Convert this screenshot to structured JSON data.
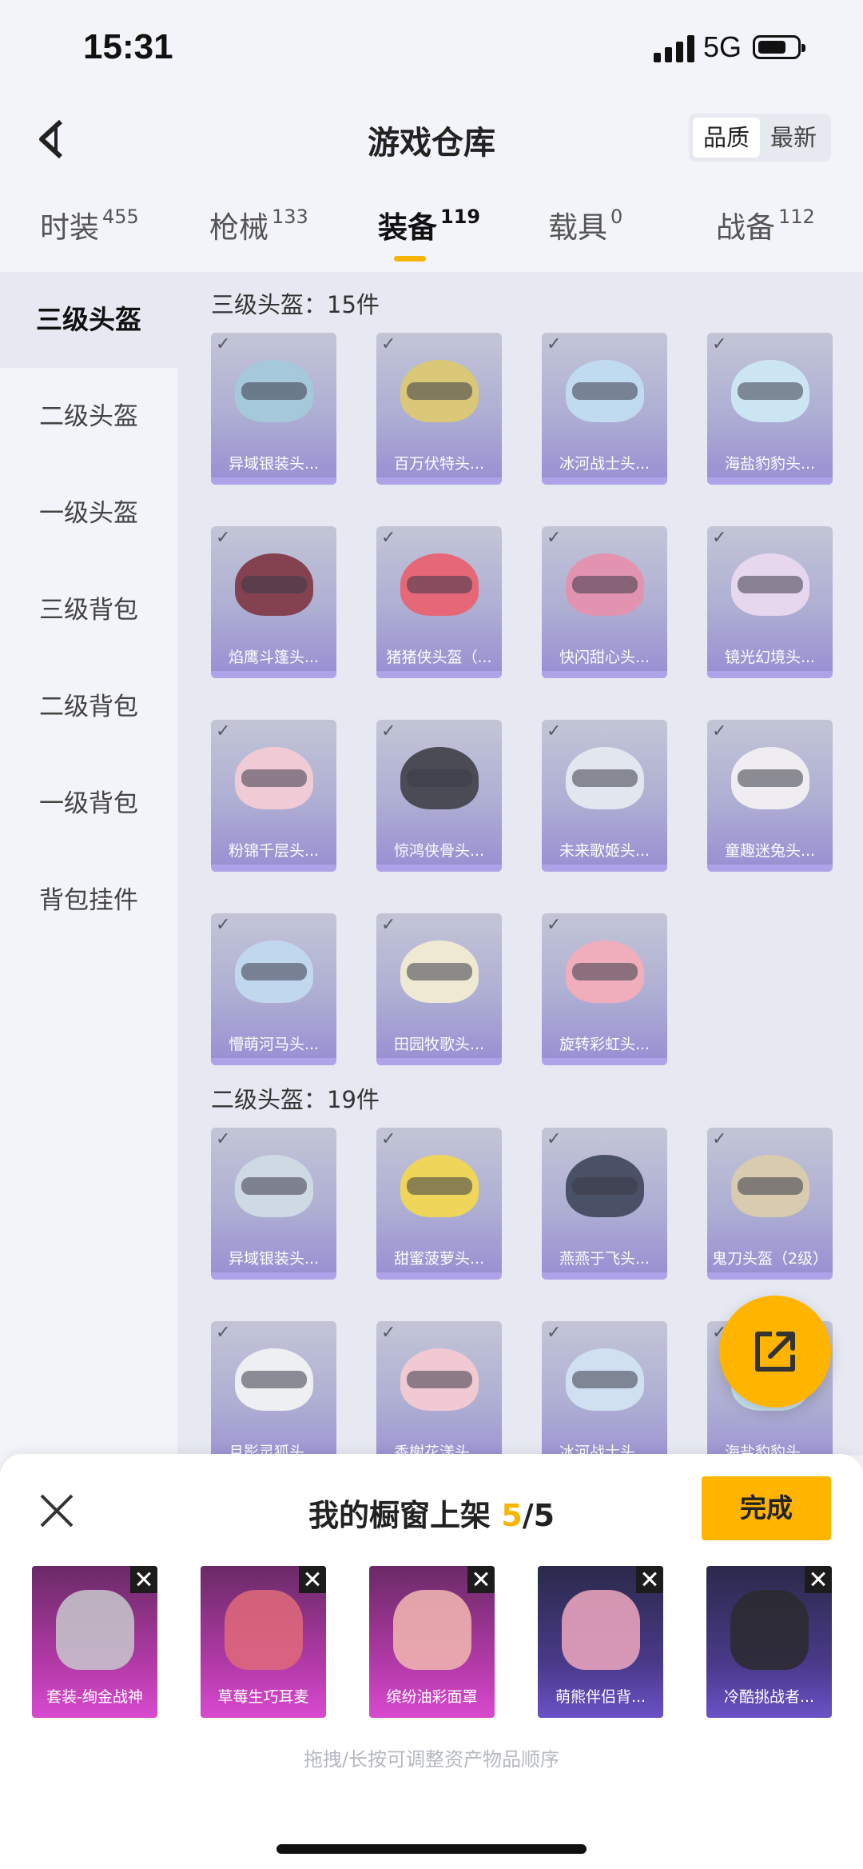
{
  "status_bar": {
    "time": "15:31",
    "network": "5G"
  },
  "header": {
    "title": "游戏仓库",
    "sort_options": [
      "品质",
      "最新"
    ],
    "sort_selected": "品质"
  },
  "tabs": [
    {
      "label": "时装",
      "count": "455"
    },
    {
      "label": "枪械",
      "count": "133"
    },
    {
      "label": "装备",
      "count": "119",
      "active": true
    },
    {
      "label": "载具",
      "count": "0"
    },
    {
      "label": "战备",
      "count": "112"
    }
  ],
  "sidebar": {
    "items": [
      "三级头盔",
      "二级头盔",
      "一级头盔",
      "三级背包",
      "二级背包",
      "一级背包",
      "背包挂件"
    ],
    "active_index": 0
  },
  "sections": [
    {
      "title": "三级头盔：15件",
      "items": [
        {
          "name": "异域银装头...",
          "color": "#9ec6d8"
        },
        {
          "name": "百万伏特头...",
          "color": "#d9c46a"
        },
        {
          "name": "冰河战士头...",
          "color": "#bcd9f0"
        },
        {
          "name": "海盐豹豹头...",
          "color": "#c9e6f3"
        },
        {
          "name": "焰鹰斗篷头...",
          "color": "#7a3040"
        },
        {
          "name": "猪猪侠头盔（...",
          "color": "#e65a6a"
        },
        {
          "name": "快闪甜心头...",
          "color": "#e28aa8"
        },
        {
          "name": "镜光幻境头...",
          "color": "#e8d6ee"
        },
        {
          "name": "粉锦千层头...",
          "color": "#f2c8d4"
        },
        {
          "name": "惊鸿侠骨头...",
          "color": "#3a3a44"
        },
        {
          "name": "未来歌姬头...",
          "color": "#e2e6ee"
        },
        {
          "name": "童趣迷兔头...",
          "color": "#f0eef2"
        },
        {
          "name": "懵萌河马头...",
          "color": "#bcd6ee"
        },
        {
          "name": "田园牧歌头...",
          "color": "#f0ead0"
        },
        {
          "name": "旋转彩虹头...",
          "color": "#f2a8b8"
        }
      ]
    },
    {
      "title": "二级头盔：19件",
      "items": [
        {
          "name": "异域银装头...",
          "color": "#cdd8e2"
        },
        {
          "name": "甜蜜菠萝头...",
          "color": "#f0d44a"
        },
        {
          "name": "燕燕于飞头...",
          "color": "#3a4058"
        },
        {
          "name": "鬼刀头盔（2级）",
          "color": "#d8c8a8"
        },
        {
          "name": "月影灵狐头...",
          "color": "#eef0f4"
        },
        {
          "name": "香榭花漾头...",
          "color": "#f2c6d0"
        },
        {
          "name": "冰河战士头...",
          "color": "#cfe0f2"
        },
        {
          "name": "海盐豹豹头...",
          "color": "#c9e6f3"
        }
      ]
    }
  ],
  "showcase": {
    "title_prefix": "我的橱窗上架",
    "current": "5",
    "total": "/5",
    "done_label": "完成",
    "items": [
      {
        "name": "套装-绚金战神",
        "style": "pink"
      },
      {
        "name": "草莓生巧耳麦",
        "style": "pink"
      },
      {
        "name": "缤纷油彩面罩",
        "style": "pink"
      },
      {
        "name": "萌熊伴侣背...",
        "style": "blue"
      },
      {
        "name": "冷酷挑战者...",
        "style": "blue"
      }
    ],
    "hint": "拖拽/长按可调整资产物品顺序"
  }
}
